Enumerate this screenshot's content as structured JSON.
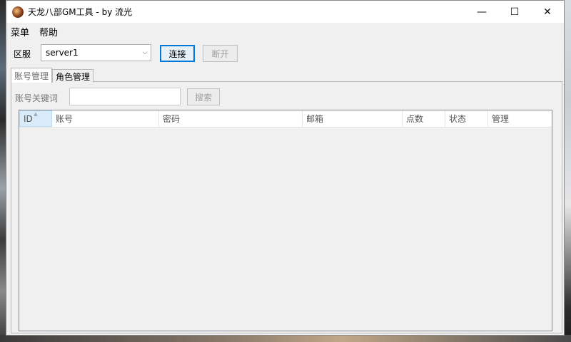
{
  "window": {
    "title": "天龙八部GM工具 - by 流光",
    "controls": {
      "minimize": "—",
      "maximize": "☐",
      "close": "✕"
    }
  },
  "menu": {
    "items": [
      "菜单",
      "帮助"
    ]
  },
  "toolbar": {
    "server_label": "区服",
    "server_value": "server1",
    "connect_label": "连接",
    "disconnect_label": "断开"
  },
  "tabs": [
    {
      "label": "账号管理",
      "active": true
    },
    {
      "label": "角色管理",
      "active": false
    }
  ],
  "search": {
    "label": "账号关键词",
    "value": "",
    "button_label": "搜索"
  },
  "grid": {
    "columns": [
      "ID",
      "账号",
      "密码",
      "邮箱",
      "点数",
      "状态",
      "管理"
    ],
    "sorted_column": "ID",
    "rows": []
  }
}
